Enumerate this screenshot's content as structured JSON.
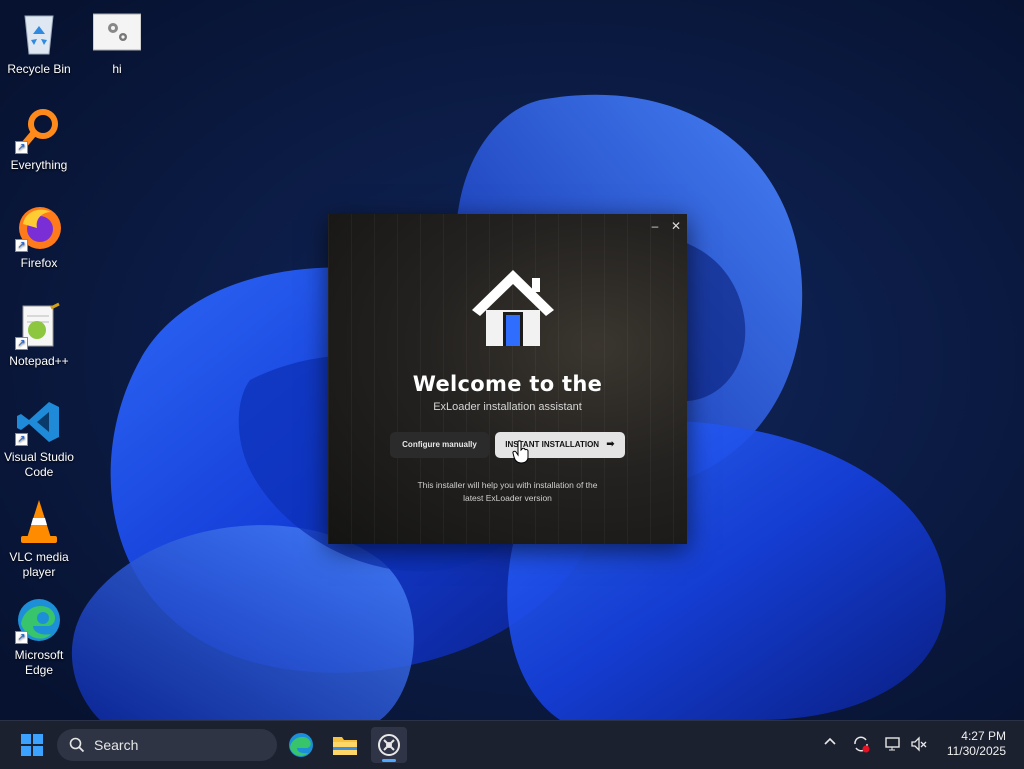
{
  "desktop": {
    "icons": [
      {
        "label": "Recycle Bin"
      },
      {
        "label": "hi"
      },
      {
        "label": "Everything"
      },
      {
        "label": "Firefox"
      },
      {
        "label": "Notepad++"
      },
      {
        "label": "Visual Studio Code"
      },
      {
        "label": "VLC media player"
      },
      {
        "label": "Microsoft Edge"
      }
    ]
  },
  "installer": {
    "title": "Welcome to the",
    "subtitle": "ExLoader installation assistant",
    "configure_label": "Configure manually",
    "instant_label": "INSTANT INSTALLATION",
    "note_line1": "This installer will help you with installation of the",
    "note_line2": "latest ExLoader version",
    "minimize": "–",
    "close": "✕"
  },
  "taskbar": {
    "search_label": "Search",
    "time": "4:27 PM",
    "date": "11/30/2025",
    "pinned": [
      "start-icon",
      "search-icon",
      "edge-icon",
      "file-explorer-icon",
      "exloader-icon"
    ],
    "tray": [
      "chevron-up-icon",
      "sync-icon",
      "display-icon",
      "volume-muted-icon"
    ]
  },
  "colors": {
    "accent_blue": "#1f5fff",
    "taskbar_bg": "#1c2130"
  }
}
